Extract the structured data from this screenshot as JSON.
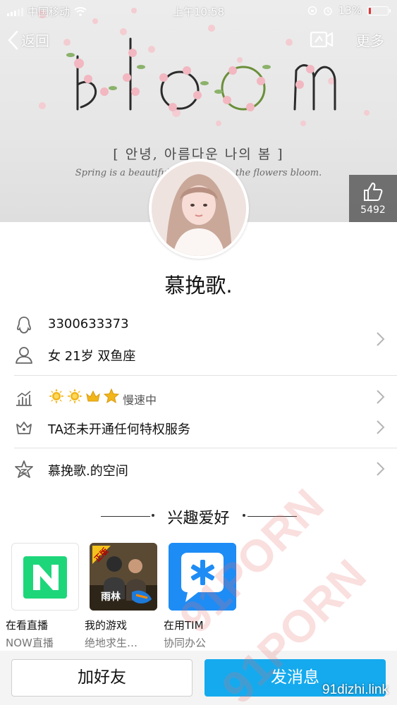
{
  "status_bar": {
    "carrier": "中国移动",
    "time": "上午10:58",
    "battery_percent": "13%",
    "battery_level": 0.13,
    "battery_color": "#e33333"
  },
  "nav": {
    "back_label": "返回",
    "more_label": "更多"
  },
  "banner": {
    "title_art": "bloom",
    "korean_text": "[ 안녕, 아름다운 나의 봄 ]",
    "english_text": "Spring is a beautiful season when the flowers bloom."
  },
  "like": {
    "count": "5492"
  },
  "profile": {
    "nickname": "慕挽歌.",
    "qq_number": "3300633373",
    "basic_info": "女 21岁 双鱼座",
    "level_status": "慢速中",
    "level_crowns": [
      "sun-icon",
      "sun-icon",
      "crown-icon",
      "star-icon"
    ],
    "privilege": "TA还未开通任何特权服务",
    "space": "慕挽歌.的空间"
  },
  "interests": {
    "title": "兴趣爱好",
    "items": [
      {
        "label": "在看直播",
        "sub": "NOW直播",
        "icon": "now-live-icon",
        "color": "#1ed67a"
      },
      {
        "label": "我的游戏",
        "sub": "绝地求生…",
        "icon": "pubg-game-icon",
        "badge": "正版",
        "brand": "雨林"
      },
      {
        "label": "在用TIM",
        "sub": "协同办公",
        "icon": "tim-icon",
        "color": "#1e8cf5"
      }
    ]
  },
  "actions": {
    "add_friend": "加好友",
    "send_message": "发消息"
  },
  "watermark": {
    "text": "91PORN",
    "site": "91dizhi.link"
  },
  "colors": {
    "accent": "#15aaee",
    "crown_gold": "#f2b51a"
  }
}
